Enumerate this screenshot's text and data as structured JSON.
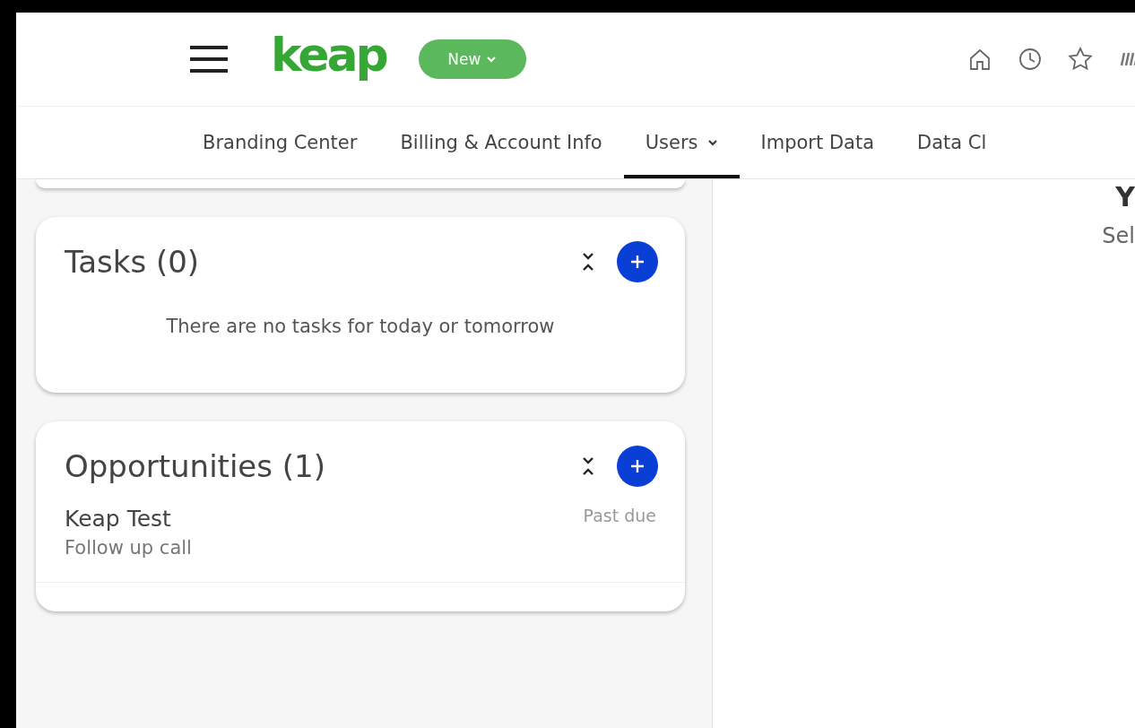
{
  "header": {
    "logo": "keap",
    "new_button": "New"
  },
  "tabs": [
    {
      "label": "Branding Center",
      "selected": false,
      "dropdown": false
    },
    {
      "label": "Billing & Account Info",
      "selected": false,
      "dropdown": false
    },
    {
      "label": "Users",
      "selected": true,
      "dropdown": true
    },
    {
      "label": "Import Data",
      "selected": false,
      "dropdown": false
    },
    {
      "label": "Data Cl",
      "selected": false,
      "dropdown": false
    }
  ],
  "cards": [
    {
      "title": "Tasks (0)",
      "empty_message": "There are no tasks for today or tomorrow"
    },
    {
      "title": "Opportunities (1)",
      "items": [
        {
          "name": "Keap Test",
          "subtitle": "Follow up call",
          "status": "Past due"
        }
      ]
    }
  ],
  "right_panel": {
    "heading": "Y",
    "subtext": "Sel"
  }
}
